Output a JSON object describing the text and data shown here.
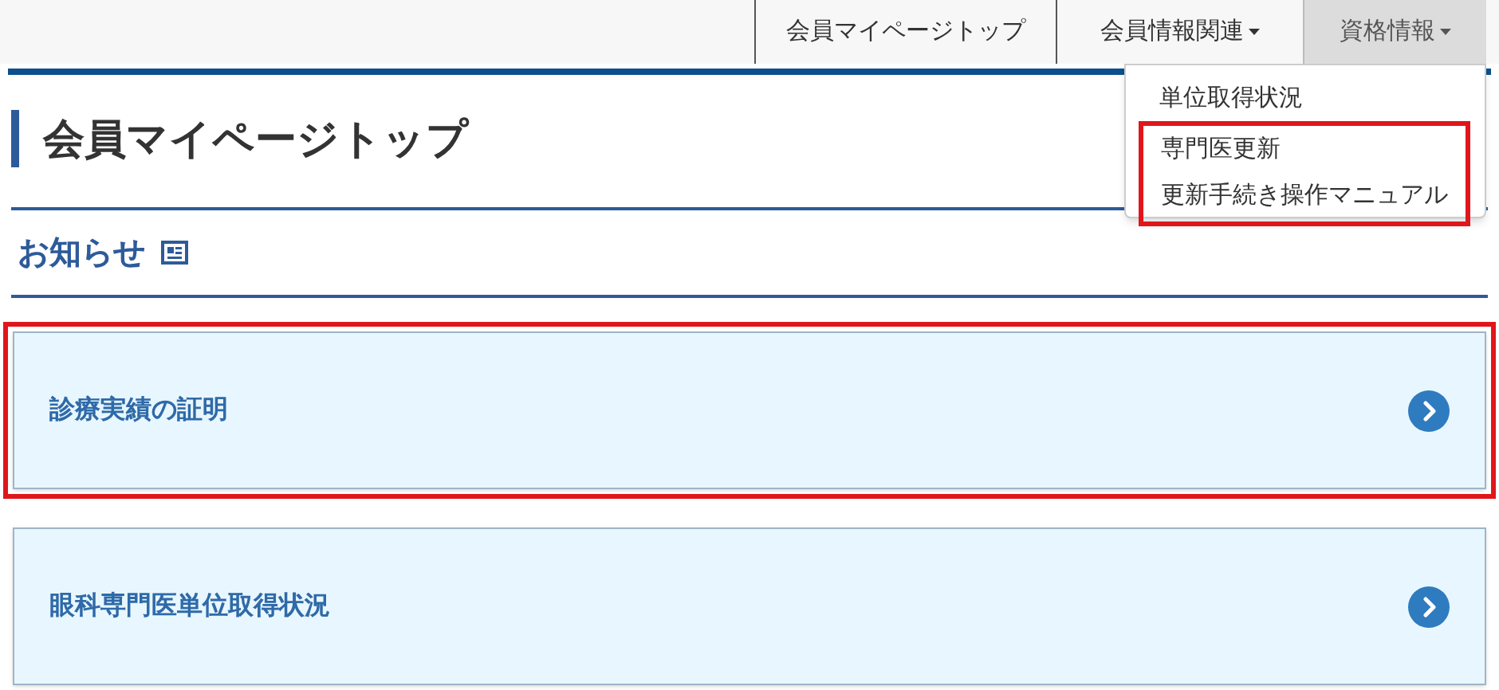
{
  "nav": {
    "items": [
      {
        "label": "会員マイページトップ",
        "selected": false,
        "has_menu": false
      },
      {
        "label": "会員情報関連",
        "selected": false,
        "has_menu": true
      },
      {
        "label": "資格情報",
        "selected": true,
        "has_menu": true
      }
    ]
  },
  "dropdown": {
    "items": [
      {
        "label": "単位取得状況",
        "highlighted": false
      },
      {
        "label": "専門医更新",
        "highlighted": true
      },
      {
        "label": "更新手続き操作マニュアル",
        "highlighted": true
      }
    ]
  },
  "page_title": "会員マイページトップ",
  "section_title": "お知らせ",
  "cards": [
    {
      "label": "診療実績の証明",
      "highlighted": true
    },
    {
      "label": "眼科専門医単位取得状況",
      "highlighted": false
    }
  ]
}
